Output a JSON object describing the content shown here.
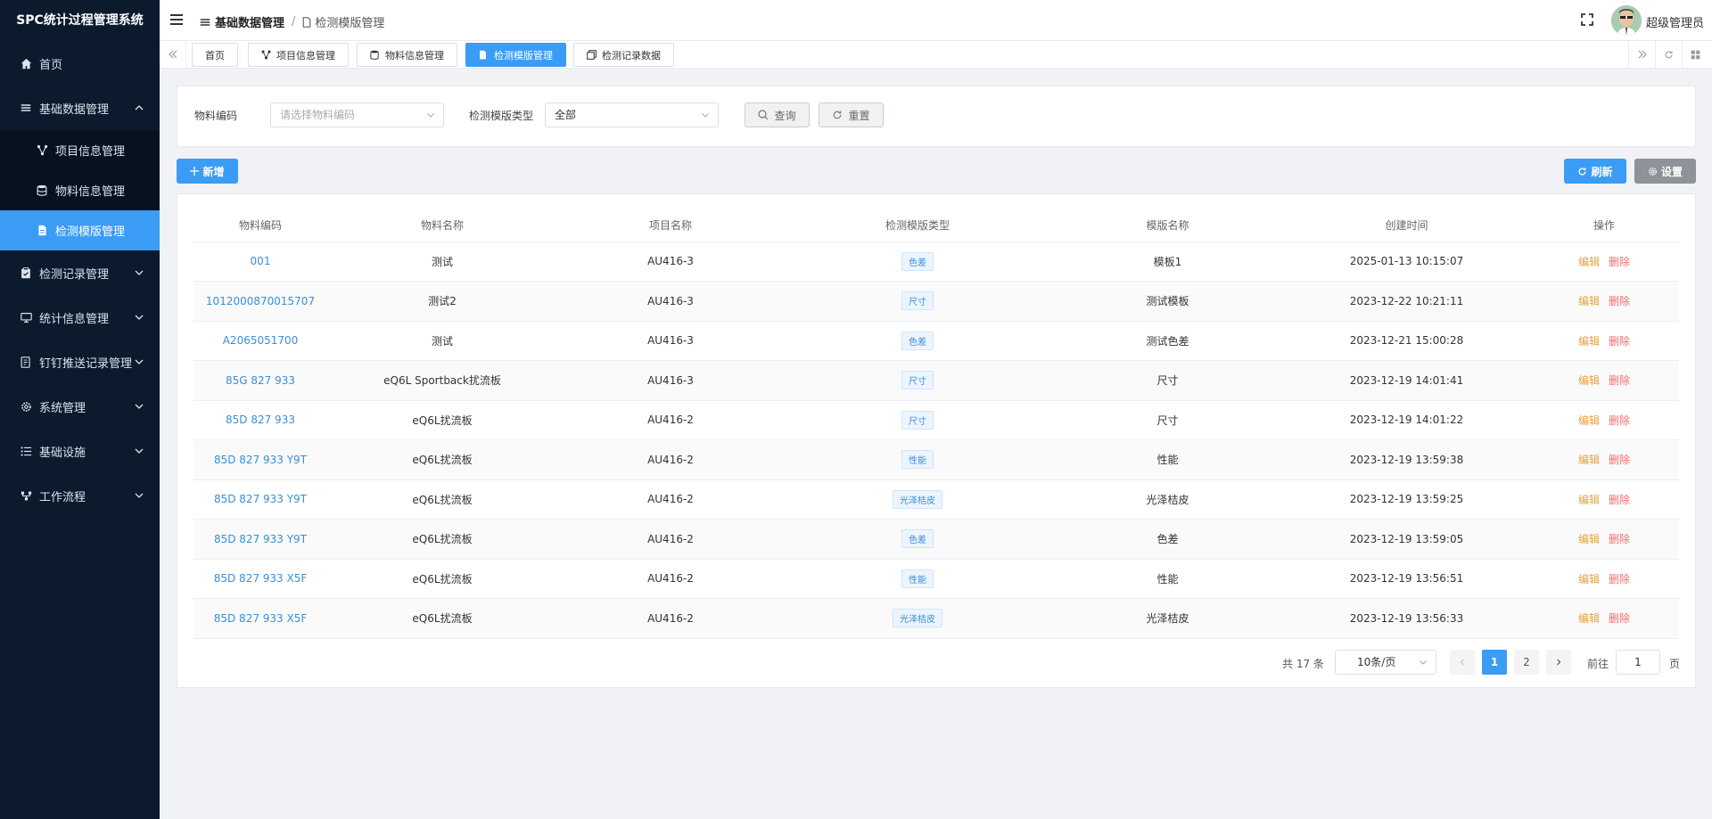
{
  "app": {
    "title": "SPC统计过程管理系统"
  },
  "sidebar": {
    "items": [
      {
        "label": "首页",
        "icon": "home-icon",
        "type": "leaf"
      },
      {
        "label": "基础数据管理",
        "icon": "list-icon",
        "type": "group",
        "expanded": true,
        "children": [
          {
            "label": "项目信息管理",
            "icon": "nodes-icon"
          },
          {
            "label": "物料信息管理",
            "icon": "database-icon"
          },
          {
            "label": "检测模版管理",
            "icon": "file-icon",
            "active": true
          }
        ]
      },
      {
        "label": "检测记录管理",
        "icon": "clipboard-icon",
        "type": "group"
      },
      {
        "label": "统计信息管理",
        "icon": "monitor-icon",
        "type": "group"
      },
      {
        "label": "钉钉推送记录管理",
        "icon": "doc-edit-icon",
        "type": "group"
      },
      {
        "label": "系统管理",
        "icon": "gear-icon",
        "type": "group"
      },
      {
        "label": "基础设施",
        "icon": "bullet-list-icon",
        "type": "group"
      },
      {
        "label": "工作流程",
        "icon": "flow-icon",
        "type": "group"
      }
    ]
  },
  "header": {
    "breadcrumb": {
      "parent": "基础数据管理",
      "separator": "/",
      "current": "检测模版管理"
    },
    "username": "超级管理员"
  },
  "tags": [
    {
      "label": "首页"
    },
    {
      "label": "项目信息管理"
    },
    {
      "label": "物料信息管理"
    },
    {
      "label": "检测模版管理",
      "active": true
    },
    {
      "label": "检测记录数据"
    }
  ],
  "search": {
    "material_code_label": "物料编码",
    "material_code_placeholder": "请选择物料编码",
    "template_type_label": "检测模版类型",
    "template_type_value": "全部",
    "query_label": "查询",
    "reset_label": "重置"
  },
  "toolbar": {
    "add_label": "新增",
    "refresh_label": "刷新",
    "settings_label": "设置"
  },
  "table": {
    "columns": [
      "物料编码",
      "物料名称",
      "项目名称",
      "检测模版类型",
      "模版名称",
      "创建时间",
      "操作"
    ],
    "edit_label": "编辑",
    "delete_label": "删除",
    "rows": [
      {
        "code": "001",
        "material": "测试",
        "project": "AU416-3",
        "type": "色差",
        "template": "模板1",
        "created": "2025-01-13 10:15:07"
      },
      {
        "code": "1012000870015707",
        "material": "测试2",
        "project": "AU416-3",
        "type": "尺寸",
        "template": "测试模板",
        "created": "2023-12-22 10:21:11"
      },
      {
        "code": "A2065051700",
        "material": "测试",
        "project": "AU416-3",
        "type": "色差",
        "template": "测试色差",
        "created": "2023-12-21 15:00:28"
      },
      {
        "code": "85G 827 933",
        "material": "eQ6L Sportback扰流板",
        "project": "AU416-3",
        "type": "尺寸",
        "template": "尺寸",
        "created": "2023-12-19 14:01:41"
      },
      {
        "code": "85D 827 933",
        "material": "eQ6L扰流板",
        "project": "AU416-2",
        "type": "尺寸",
        "template": "尺寸",
        "created": "2023-12-19 14:01:22"
      },
      {
        "code": "85D 827 933 Y9T",
        "material": "eQ6L扰流板",
        "project": "AU416-2",
        "type": "性能",
        "template": "性能",
        "created": "2023-12-19 13:59:38"
      },
      {
        "code": "85D 827 933 Y9T",
        "material": "eQ6L扰流板",
        "project": "AU416-2",
        "type": "光泽桔皮",
        "template": "光泽桔皮",
        "created": "2023-12-19 13:59:25"
      },
      {
        "code": "85D 827 933 Y9T",
        "material": "eQ6L扰流板",
        "project": "AU416-2",
        "type": "色差",
        "template": "色差",
        "created": "2023-12-19 13:59:05"
      },
      {
        "code": "85D 827 933 X5F",
        "material": "eQ6L扰流板",
        "project": "AU416-2",
        "type": "性能",
        "template": "性能",
        "created": "2023-12-19 13:56:51"
      },
      {
        "code": "85D 827 933 X5F",
        "material": "eQ6L扰流板",
        "project": "AU416-2",
        "type": "光泽桔皮",
        "template": "光泽桔皮",
        "created": "2023-12-19 13:56:33"
      }
    ]
  },
  "pagination": {
    "total_text": "共 17 条",
    "page_size": "10条/页",
    "pages": [
      "1",
      "2"
    ],
    "current_page": "1",
    "goto_label": "前往",
    "goto_value": "1",
    "page_suffix": "页"
  },
  "colors": {
    "primary": "#3a9cf5",
    "sidebar_bg": "#0c1a2e",
    "edit": "#e6a23c",
    "delete": "#f56c6c",
    "link": "#3a8fd6"
  }
}
